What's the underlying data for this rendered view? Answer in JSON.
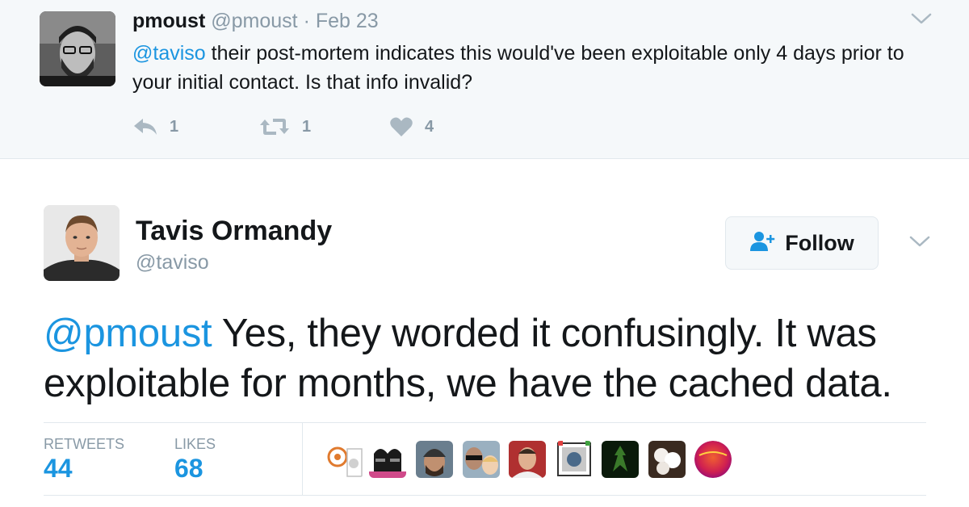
{
  "parent_tweet": {
    "name": "pmoust",
    "handle": "@pmoust",
    "separator": "·",
    "date": "Feb 23",
    "mention": "@taviso",
    "text": " their post-mortem indicates this would've been exploitable only 4 days prior to your initial contact. Is that info invalid?",
    "reply_count": "1",
    "retweet_count": "1",
    "like_count": "4"
  },
  "main_tweet": {
    "name": "Tavis Ormandy",
    "handle": "@taviso",
    "follow_label": "Follow",
    "mention": "@pmoust",
    "text": " Yes, they worded it confusingly. It was exploitable for months, we have the cached data.",
    "stats": {
      "retweets_label": "RETWEETS",
      "retweets_value": "44",
      "likes_label": "LIKES",
      "likes_value": "68"
    }
  },
  "colors": {
    "accent": "#1b95e0",
    "muted": "#8899a6",
    "text": "#14171a",
    "parent_bg": "#f5f8fa",
    "border": "#e1e8ed"
  },
  "icons": {
    "reply": "reply-icon",
    "retweet": "retweet-icon",
    "like": "heart-icon",
    "follow": "add-user-icon",
    "more": "chevron-down-icon"
  }
}
